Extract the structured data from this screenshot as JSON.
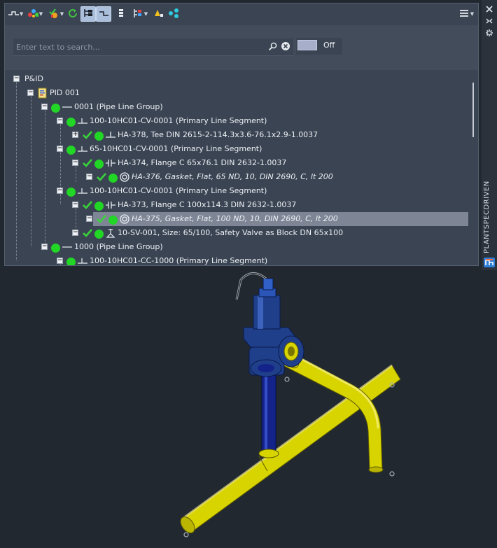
{
  "toolbar": {
    "buttons": [
      {
        "name": "line-type-icon",
        "active": false,
        "dropdown": true
      },
      {
        "name": "color-nodes-icon",
        "active": false,
        "dropdown": true
      },
      {
        "name": "validate-filter-icon",
        "active": false,
        "dropdown": true
      },
      {
        "name": "refresh-icon",
        "active": false,
        "dropdown": false
      },
      {
        "name": "tree-structure-icon",
        "active": true,
        "dropdown": false
      },
      {
        "name": "segment-line-icon",
        "active": true,
        "dropdown": false
      },
      {
        "name": "column-icon",
        "active": false,
        "dropdown": false
      },
      {
        "name": "grouping-icon",
        "active": false,
        "dropdown": true
      },
      {
        "name": "warning-sort-icon",
        "active": false,
        "dropdown": false
      },
      {
        "name": "connect-nodes-icon",
        "active": false,
        "dropdown": false
      }
    ],
    "menu_icon": "hamburger-menu-icon"
  },
  "search": {
    "placeholder": "Enter text to search...",
    "value": "",
    "search_icon": "search-icon",
    "clear_icon": "clear-icon"
  },
  "toggle": {
    "label": "Off",
    "state": false
  },
  "tree": [
    {
      "level": 0,
      "label": "P&ID",
      "icon": "none",
      "check": false,
      "dot": false,
      "expander": "minus",
      "italic": false,
      "selected": false
    },
    {
      "level": 1,
      "label": "PID 001",
      "icon": "pid-document-icon",
      "check": false,
      "dot": false,
      "expander": "minus",
      "italic": false,
      "selected": false
    },
    {
      "level": 2,
      "label": "0001 (Pipe Line Group)",
      "icon": "line-group-icon",
      "check": false,
      "dot": true,
      "expander": "minus",
      "italic": false,
      "selected": false
    },
    {
      "level": 3,
      "label": "100-10HC01-CV-0001 (Primary Line Segment)",
      "icon": "line-segment-icon",
      "check": false,
      "dot": true,
      "expander": "minus",
      "italic": false,
      "selected": false
    },
    {
      "level": 4,
      "label": "HA-378, Tee DIN 2615-2-114.3x3.6-76.1x2.9-1.0037",
      "icon": "tee-icon",
      "check": true,
      "dot": true,
      "expander": "plus",
      "italic": false,
      "selected": false
    },
    {
      "level": 3,
      "label": "65-10HC01-CV-0001 (Primary Line Segment)",
      "icon": "line-segment-icon",
      "check": false,
      "dot": true,
      "expander": "minus",
      "italic": false,
      "selected": false
    },
    {
      "level": 4,
      "label": "HA-374, Flange C 65x76.1 DIN 2632-1.0037",
      "icon": "flange-icon",
      "check": true,
      "dot": true,
      "expander": "minus",
      "italic": false,
      "selected": false
    },
    {
      "level": 5,
      "label": "HA-376, Gasket, Flat, 65 ND, 10, DIN 2690, C, lt 200",
      "icon": "gasket-icon",
      "check": true,
      "dot": true,
      "expander": "minus",
      "italic": true,
      "selected": false
    },
    {
      "level": 3,
      "label": "100-10HC01-CV-0001 (Primary Line Segment)",
      "icon": "line-segment-icon",
      "check": false,
      "dot": true,
      "expander": "minus",
      "italic": false,
      "selected": false
    },
    {
      "level": 4,
      "label": "HA-373, Flange C 100x114.3 DIN 2632-1.0037",
      "icon": "flange-icon",
      "check": true,
      "dot": true,
      "expander": "minus",
      "italic": false,
      "selected": false
    },
    {
      "level": 5,
      "label": "HA-375, Gasket, Flat, 100 ND, 10, DIN 2690, C, lt 200",
      "icon": "gasket-icon",
      "check": true,
      "dot": true,
      "expander": "minus",
      "italic": true,
      "selected": true
    },
    {
      "level": 4,
      "label": "10-SV-001, Size: 65/100, Safety Valve as Block DN 65x100",
      "icon": "safety-valve-icon",
      "check": true,
      "dot": true,
      "expander": "minus",
      "italic": false,
      "selected": false
    },
    {
      "level": 2,
      "label": "1000 (Pipe Line Group)",
      "icon": "line-group-icon",
      "check": false,
      "dot": true,
      "expander": "minus",
      "italic": false,
      "selected": false
    },
    {
      "level": 3,
      "label": "100-10HC01-CC-1000 (Primary Line Segment)",
      "icon": "line-segment-icon",
      "check": false,
      "dot": true,
      "expander": "minus",
      "italic": false,
      "selected": false
    }
  ],
  "side_panel": {
    "title": "PLANTSPECDRIVEN",
    "icons": [
      "close-icon",
      "auto-hide-icon",
      "properties-icon",
      "app-logo-icon"
    ]
  },
  "colors": {
    "panel_bg": "#3b4453",
    "selection": "#7e8696",
    "status_green": "#22d626",
    "check_green": "#39d43a",
    "pipe_yellow": "#d8d400",
    "valve_blue": "#1f3f8a",
    "viewport_bg": "#212830"
  }
}
